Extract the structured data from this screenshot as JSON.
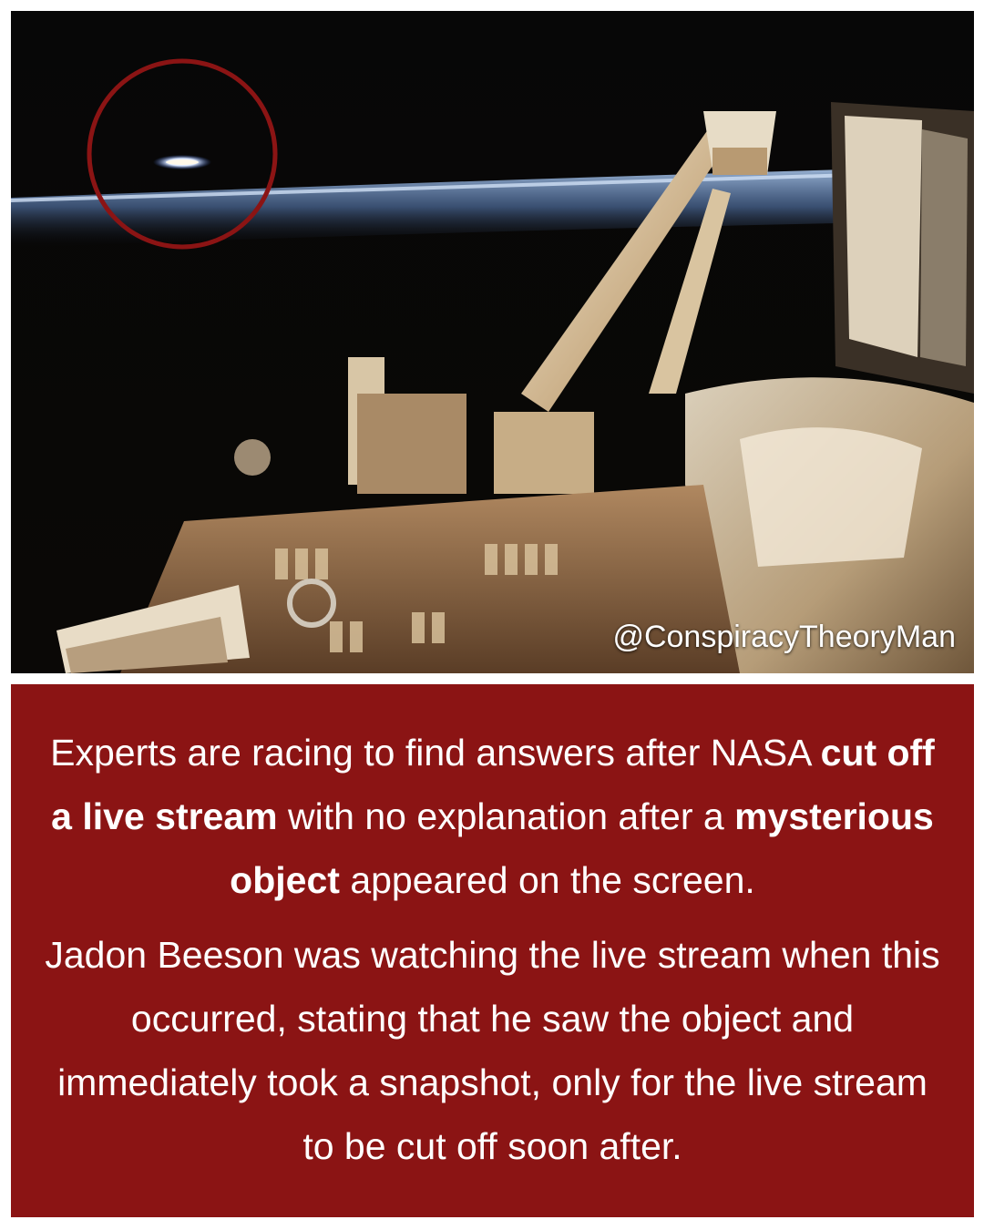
{
  "photo": {
    "handle": "@ConspiracyTheoryMan",
    "circle_color": "#8b1414",
    "horizon_color": "#8fb0d8"
  },
  "caption": {
    "background": "#8b1414",
    "paragraph1": {
      "part1": "Experts are racing to find answers after NASA ",
      "bold1": "cut off a live stream",
      "part2": " with no explanation after a ",
      "bold2": "mysterious object",
      "part3": " appeared on the screen."
    },
    "paragraph2": "Jadon Beeson was watching the live stream when this occurred, stating that he saw the object and immediately took a snapshot, only for the live stream to be cut off soon after."
  }
}
